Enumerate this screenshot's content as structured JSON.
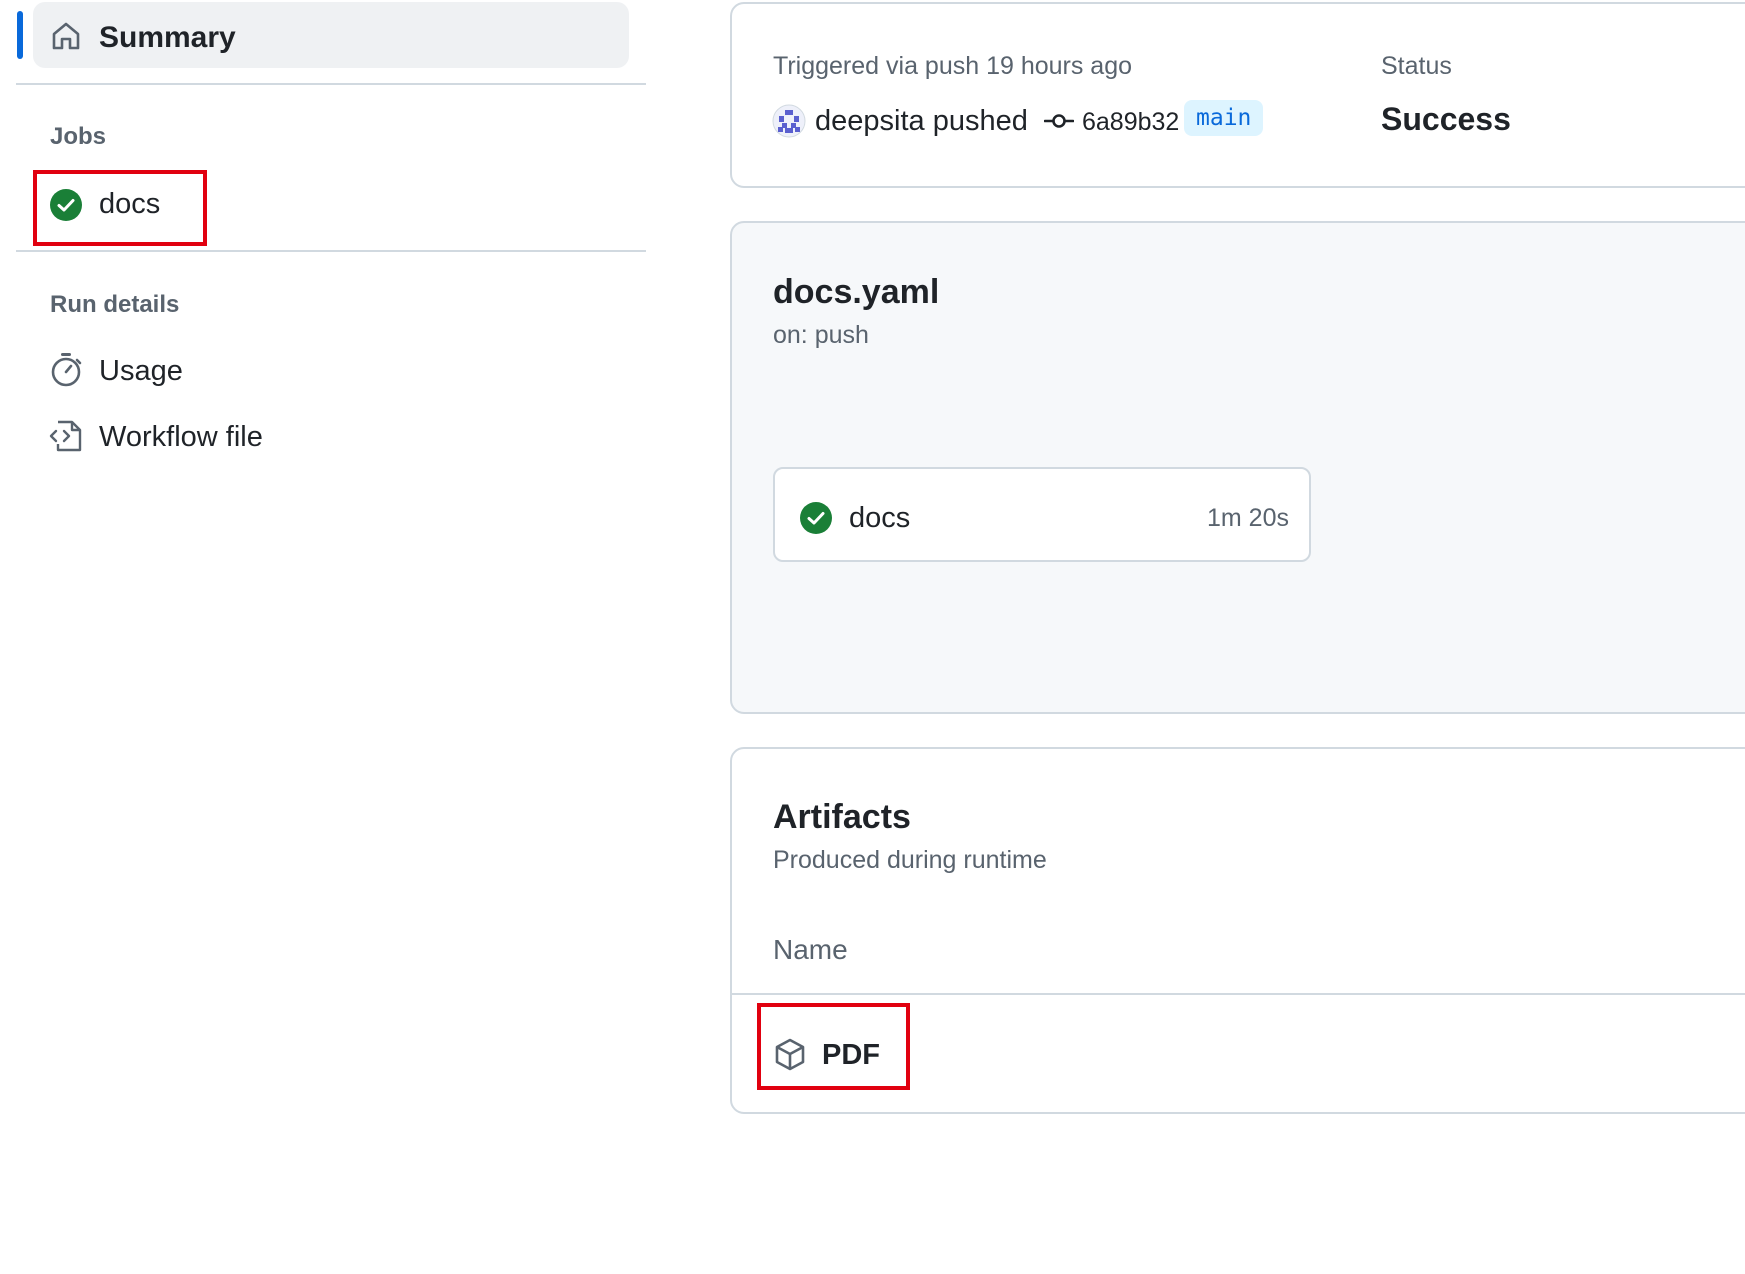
{
  "sidebar": {
    "summary_label": "Summary",
    "jobs_heading": "Jobs",
    "jobs": [
      {
        "label": "docs",
        "status": "success"
      }
    ],
    "run_details_heading": "Run details",
    "usage_label": "Usage",
    "workflow_file_label": "Workflow file"
  },
  "run_info": {
    "triggered_text": "Triggered via push 19 hours ago",
    "actor_text": "deepsita pushed",
    "commit_sha": "6a89b32",
    "branch": "main",
    "status_heading": "Status",
    "status_value": "Success"
  },
  "workflow": {
    "file_name": "docs.yaml",
    "trigger": "on: push",
    "job": {
      "name": "docs",
      "duration": "1m 20s",
      "status": "success"
    }
  },
  "artifacts": {
    "title": "Artifacts",
    "subtitle": "Produced during runtime",
    "column_name": "Name",
    "items": [
      {
        "name": "PDF"
      }
    ]
  },
  "colors": {
    "accent": "#0969da",
    "success": "#1a7f37",
    "highlight": "#e1000f"
  }
}
